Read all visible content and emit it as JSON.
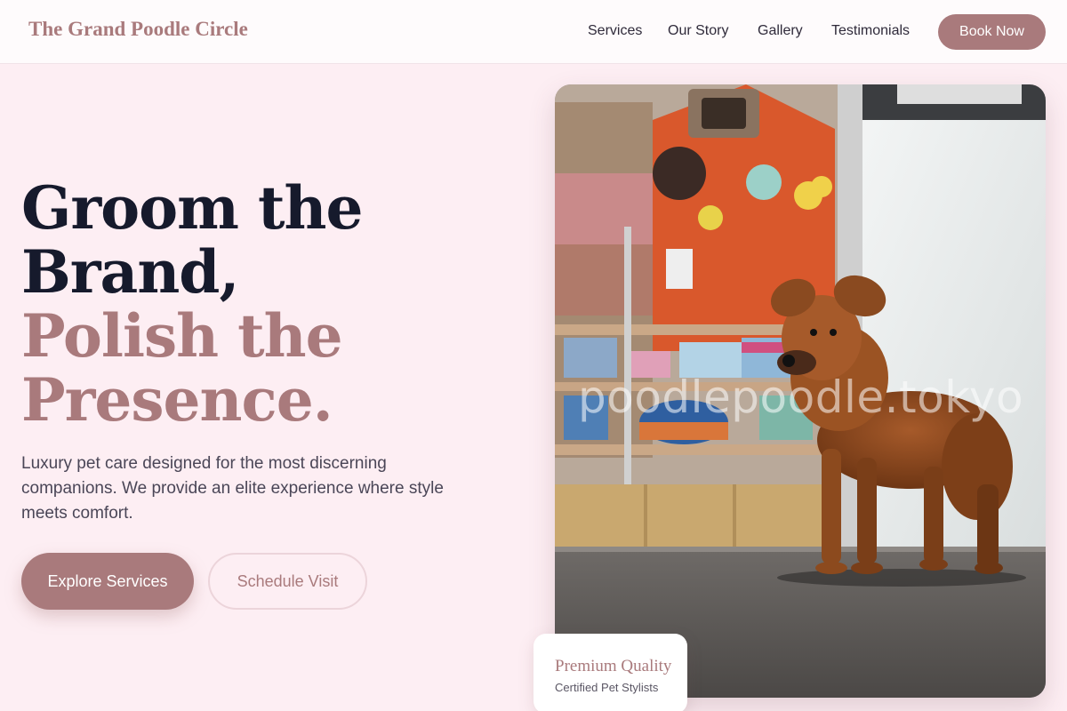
{
  "header": {
    "brand": "The Grand Poodle Circle",
    "nav": [
      "Services",
      "Our Story",
      "Gallery",
      "Testimonials"
    ],
    "cta": "Book Now"
  },
  "hero": {
    "headline_line1": "Groom the",
    "headline_line2": "Brand,",
    "headline_line3": "Polish the",
    "headline_line4": "Presence.",
    "subcopy": "Luxury pet care designed for the most discerning companions. We provide an elite experience where style meets comfort.",
    "primary_button": "Explore Services",
    "secondary_button": "Schedule Visit"
  },
  "photo": {
    "watermark": "poodlepoodle.tokyo"
  },
  "badge": {
    "title": "Premium Quality",
    "subtitle": "Certified Pet Stylists"
  },
  "colors": {
    "accent": "#a97a7c",
    "background": "#fdeef3",
    "dark_text": "#161a2c"
  }
}
